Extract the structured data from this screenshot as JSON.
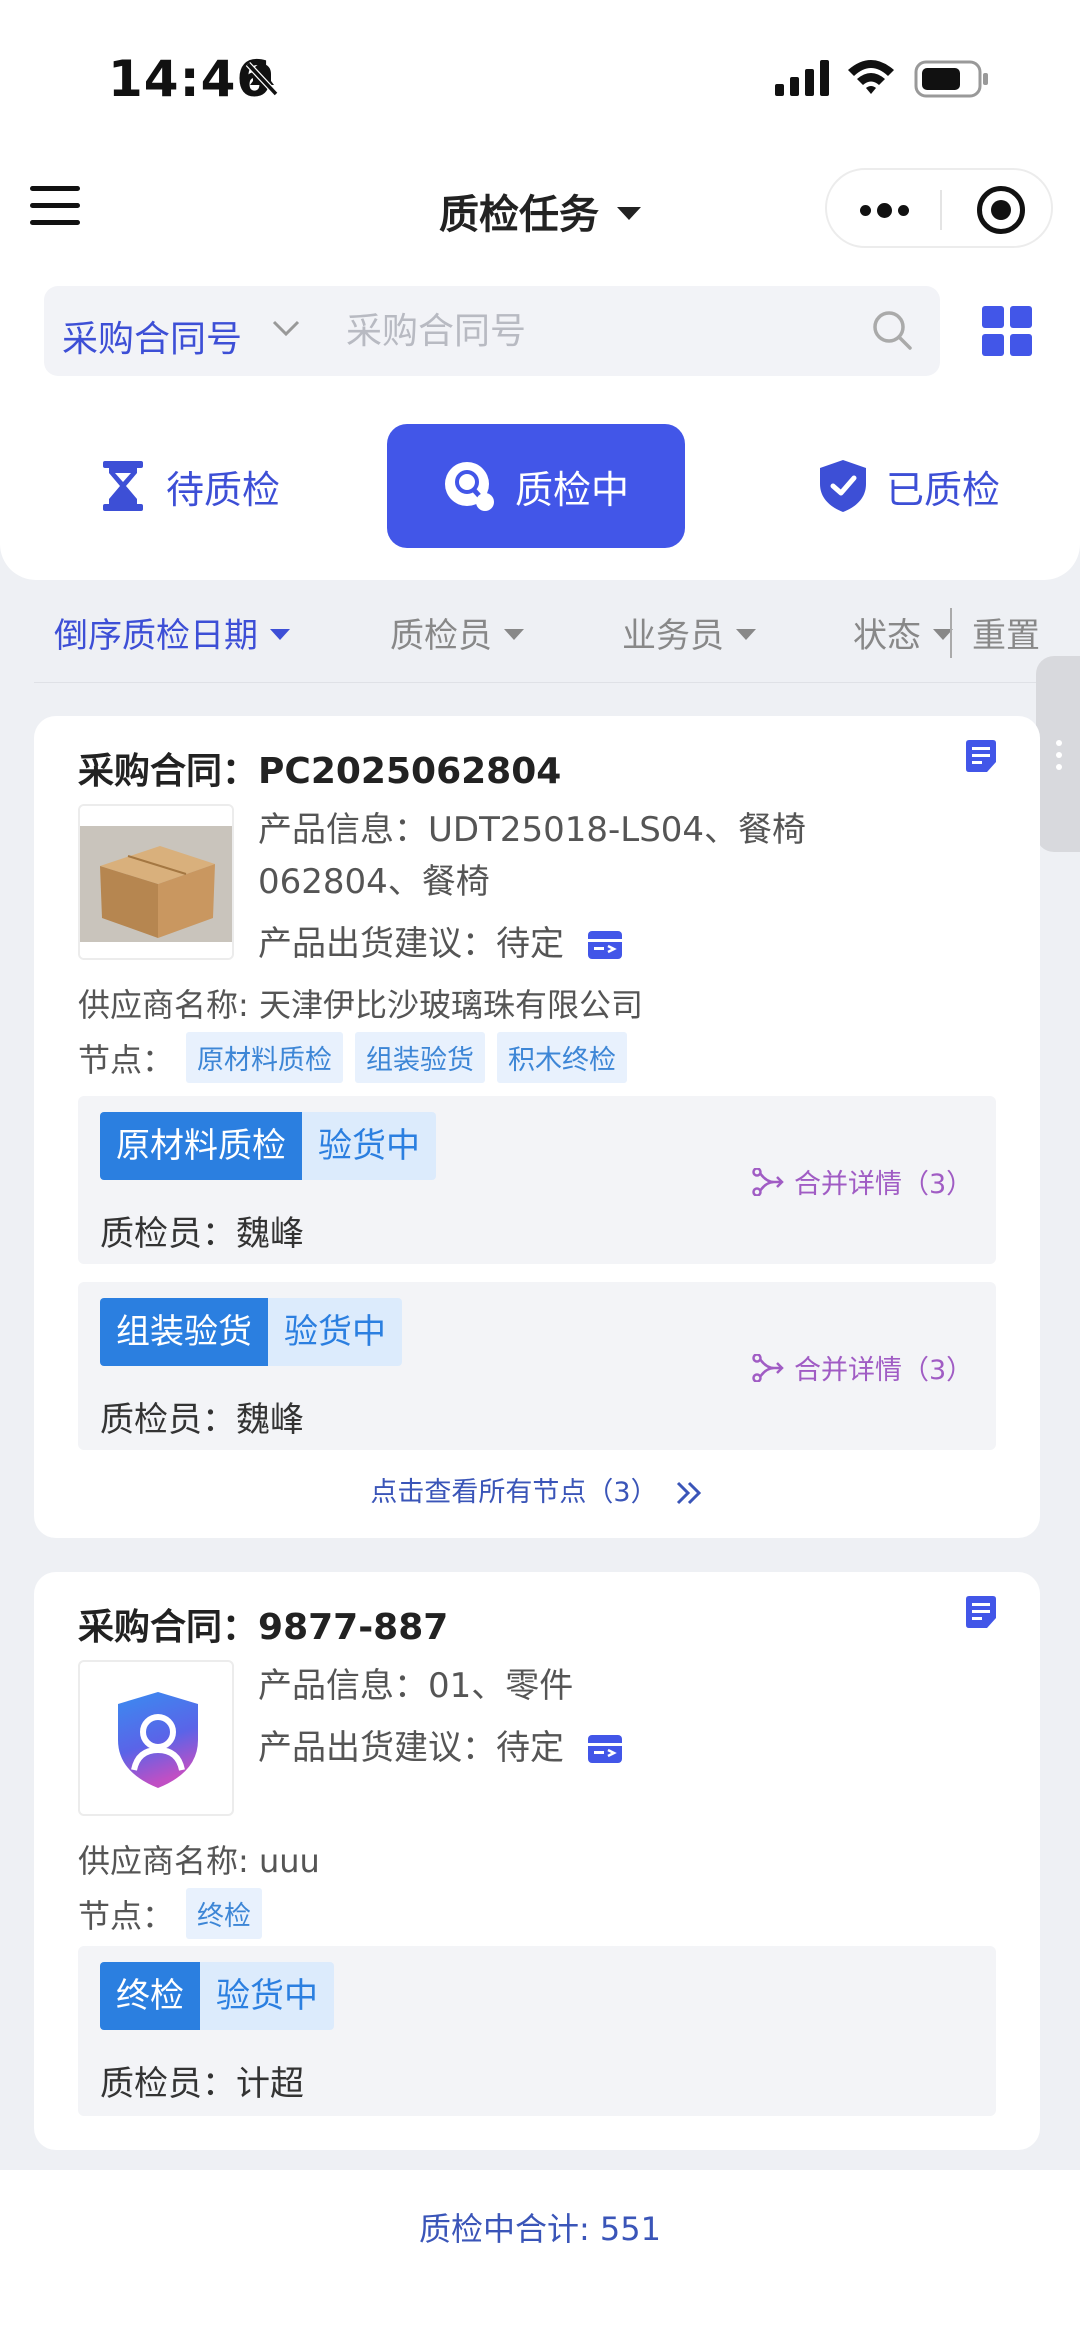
{
  "status_bar": {
    "time": "14:46"
  },
  "nav": {
    "title": "质检任务"
  },
  "search": {
    "type_label": "采购合同号",
    "placeholder": "采购合同号"
  },
  "tabs": [
    {
      "label": "待质检",
      "active": false
    },
    {
      "label": "质检中",
      "active": true
    },
    {
      "label": "已质检",
      "active": false
    }
  ],
  "filters": {
    "sort": "倒序质检日期",
    "inspector": "质检员",
    "salesman": "业务员",
    "status": "状态",
    "reset": "重置"
  },
  "cards": [
    {
      "title_prefix": "采购合同：",
      "contract_no": "PC2025062804",
      "product_info": "产品信息：UDT25018-LS04、餐椅062804、餐椅",
      "shipment_advice": "产品出货建议：待定",
      "supplier": "供应商名称: 天津伊比沙玻璃珠有限公司",
      "nodes_label": "节点：",
      "nodes": [
        "原材料质检",
        "组装验货",
        "积木终检"
      ],
      "stages": [
        {
          "name": "原材料质检",
          "state": "验货中",
          "inspector": "质检员：魏峰",
          "merge": "合并详情（3）"
        },
        {
          "name": "组装验货",
          "state": "验货中",
          "inspector": "质检员：魏峰",
          "merge": "合并详情（3）"
        }
      ],
      "view_all": "点击查看所有节点（3）"
    },
    {
      "title_prefix": "采购合同：",
      "contract_no": "9877-887",
      "product_info": "产品信息：01、零件",
      "shipment_advice": "产品出货建议：待定",
      "supplier": "供应商名称: uuu",
      "nodes_label": "节点：",
      "nodes": [
        "终检"
      ],
      "stages": [
        {
          "name": "终检",
          "state": "验货中",
          "inspector": "质检员：计超"
        }
      ]
    }
  ],
  "footer": {
    "total": "质检中合计: 551"
  },
  "colors": {
    "accent": "#4256e8",
    "link": "#3d4fd6",
    "stage": "#2b7fe0",
    "merge": "#a05cc4",
    "background": "#eef0f4"
  }
}
